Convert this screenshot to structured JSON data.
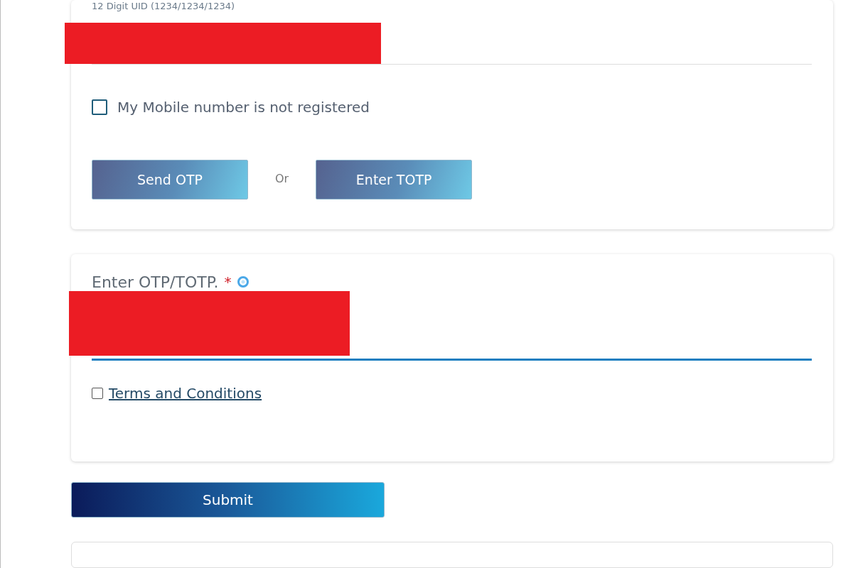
{
  "uid_card": {
    "field": {
      "label": "12 Digit UID (1234/1234/1234)",
      "redacted": true
    },
    "mobile_checkbox": {
      "label": "My Mobile number is not registered",
      "checked": false
    },
    "buttons": [
      {
        "label": "Send OTP"
      },
      {
        "label": "Enter TOTP"
      }
    ],
    "separator": "Or"
  },
  "otp_card": {
    "field": {
      "label": "Enter OTP/TOTP.",
      "required": "*",
      "redacted": true,
      "focused": true
    },
    "terms": {
      "label": "Terms and Conditions",
      "checked": false
    }
  },
  "submit": "Submit"
}
